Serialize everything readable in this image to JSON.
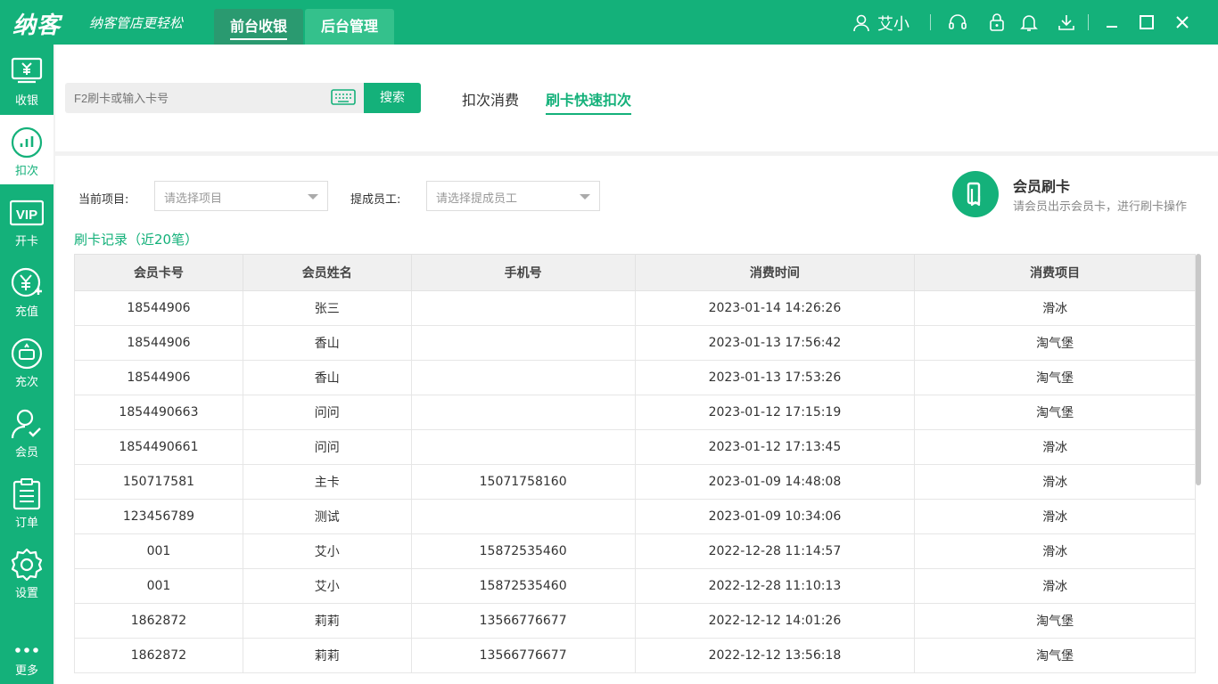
{
  "app": {
    "logo": "纳客",
    "slogan": "纳客管店更轻松",
    "tabs": [
      {
        "label": "前台收银",
        "active": true
      },
      {
        "label": "后台管理",
        "active": false
      }
    ],
    "user": "艾小",
    "accent": "#14b17a"
  },
  "sidebar": {
    "items": [
      {
        "label": "收银",
        "icon": "cashier-icon"
      },
      {
        "label": "扣次",
        "icon": "chart-icon",
        "active": true
      },
      {
        "label": "开卡",
        "icon": "vip-icon"
      },
      {
        "label": "充值",
        "icon": "recharge-icon"
      },
      {
        "label": "充次",
        "icon": "refill-icon"
      },
      {
        "label": "会员",
        "icon": "member-icon"
      },
      {
        "label": "订单",
        "icon": "order-icon"
      },
      {
        "label": "设置",
        "icon": "gear-icon"
      },
      {
        "label": "更多",
        "icon": "more-icon"
      }
    ]
  },
  "search": {
    "placeholder": "F2刷卡或输入卡号",
    "button": "搜索",
    "tabs": [
      {
        "label": "扣次消费",
        "active": false
      },
      {
        "label": "刷卡快速扣次",
        "active": true
      }
    ]
  },
  "filters": {
    "project_label": "当前项目:",
    "project_placeholder": "请选择项目",
    "staff_label": "提成员工:",
    "staff_placeholder": "请选择提成员工"
  },
  "card_prompt": {
    "title": "会员刷卡",
    "subtitle": "请会员出示会员卡，进行刷卡操作"
  },
  "records": {
    "title": "刷卡记录（近20笔）",
    "columns": [
      "会员卡号",
      "会员姓名",
      "手机号",
      "消费时间",
      "消费项目"
    ],
    "rows": [
      {
        "card": "18544906",
        "name": "张三",
        "phone": "",
        "time": "2023-01-14 14:26:26",
        "item": "滑冰"
      },
      {
        "card": "18544906",
        "name": "香山",
        "phone": "",
        "time": "2023-01-13 17:56:42",
        "item": "淘气堡"
      },
      {
        "card": "18544906",
        "name": "香山",
        "phone": "",
        "time": "2023-01-13 17:53:26",
        "item": "淘气堡"
      },
      {
        "card": "1854490663",
        "name": "问问",
        "phone": "",
        "time": "2023-01-12 17:15:19",
        "item": "淘气堡"
      },
      {
        "card": "1854490661",
        "name": "问问",
        "phone": "",
        "time": "2023-01-12 17:13:45",
        "item": "滑冰"
      },
      {
        "card": "150717581",
        "name": "主卡",
        "phone": "15071758160",
        "time": "2023-01-09 14:48:08",
        "item": "滑冰"
      },
      {
        "card": "123456789",
        "name": "测试",
        "phone": "",
        "time": "2023-01-09 10:34:06",
        "item": "滑冰"
      },
      {
        "card": "001",
        "name": "艾小",
        "phone": "15872535460",
        "time": "2022-12-28 11:14:57",
        "item": "滑冰"
      },
      {
        "card": "001",
        "name": "艾小",
        "phone": "15872535460",
        "time": "2022-12-28 11:10:13",
        "item": "滑冰"
      },
      {
        "card": "1862872",
        "name": "莉莉",
        "phone": "13566776677",
        "time": "2022-12-12 14:01:26",
        "item": "淘气堡"
      },
      {
        "card": "1862872",
        "name": "莉莉",
        "phone": "13566776677",
        "time": "2022-12-12 13:56:18",
        "item": "淘气堡"
      }
    ]
  }
}
